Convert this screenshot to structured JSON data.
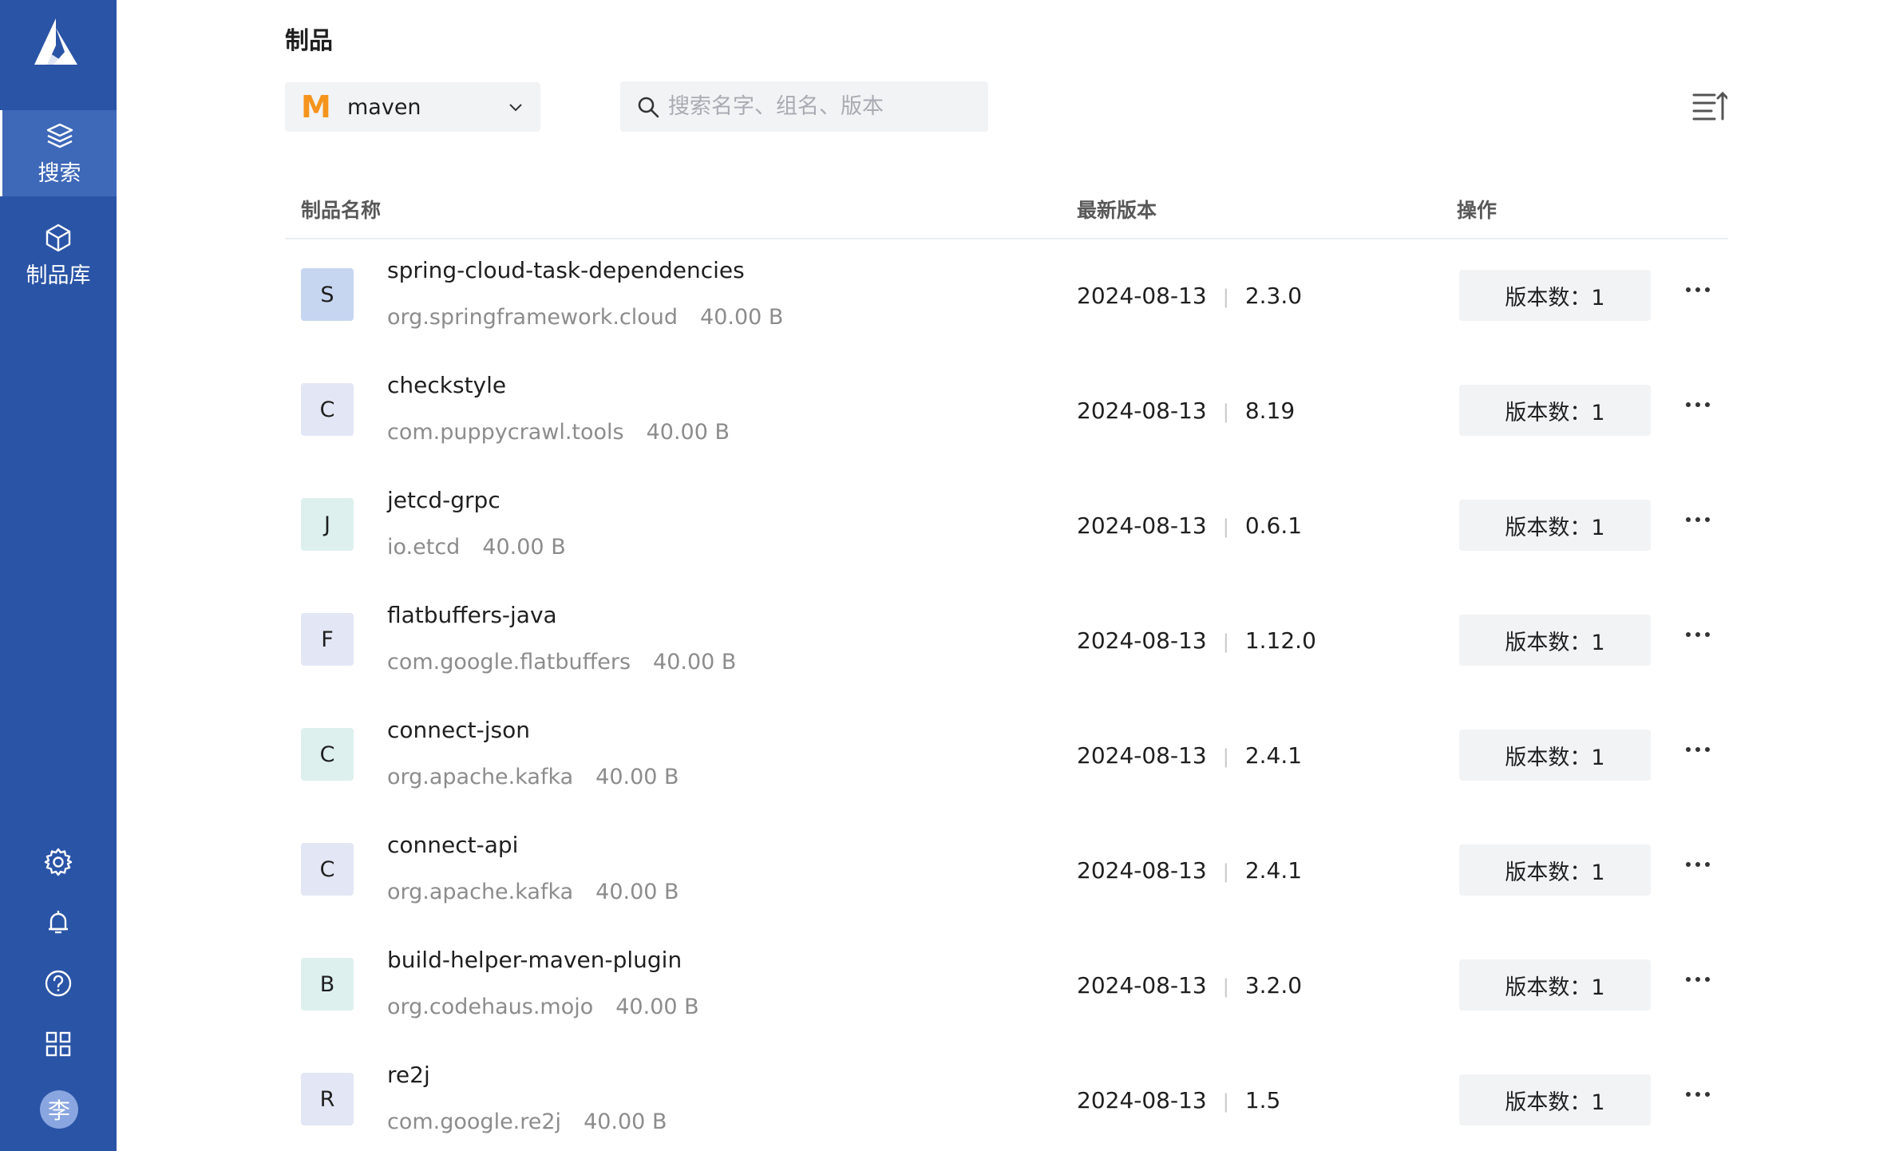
{
  "sidebar": {
    "nav": [
      {
        "label": "搜索",
        "icon": "layers-icon"
      },
      {
        "label": "制品库",
        "icon": "cube-icon"
      }
    ],
    "bottom_icons": [
      "gear-icon",
      "bell-icon",
      "help-icon",
      "apps-grid-icon"
    ],
    "avatar_text": "李",
    "colors": {
      "background": "#2a54a6",
      "active": "#3e68b8"
    }
  },
  "page": {
    "title": "制品",
    "repo_select": {
      "logo": "M",
      "value": "maven"
    },
    "search": {
      "placeholder": "搜索名字、组名、版本"
    }
  },
  "table": {
    "headers": {
      "name": "制品名称",
      "latest": "最新版本",
      "action": "操作"
    },
    "rows": [
      {
        "initial": "S",
        "badge_color": "#c6d6f1",
        "name": "spring-cloud-task-dependencies",
        "group": "org.springframework.cloud",
        "size": "40.00 B",
        "date": "2024-08-13",
        "version": "2.3.0",
        "versions_label": "版本数：1"
      },
      {
        "initial": "C",
        "badge_color": "#e3e6f4",
        "name": "checkstyle",
        "group": "com.puppycrawl.tools",
        "size": "40.00 B",
        "date": "2024-08-13",
        "version": "8.19",
        "versions_label": "版本数：1"
      },
      {
        "initial": "J",
        "badge_color": "#ddf0ee",
        "name": "jetcd-grpc",
        "group": "io.etcd",
        "size": "40.00 B",
        "date": "2024-08-13",
        "version": "0.6.1",
        "versions_label": "版本数：1"
      },
      {
        "initial": "F",
        "badge_color": "#e3e6f4",
        "name": "flatbuffers-java",
        "group": "com.google.flatbuffers",
        "size": "40.00 B",
        "date": "2024-08-13",
        "version": "1.12.0",
        "versions_label": "版本数：1"
      },
      {
        "initial": "C",
        "badge_color": "#ddf0ee",
        "name": "connect-json",
        "group": "org.apache.kafka",
        "size": "40.00 B",
        "date": "2024-08-13",
        "version": "2.4.1",
        "versions_label": "版本数：1"
      },
      {
        "initial": "C",
        "badge_color": "#e3e6f4",
        "name": "connect-api",
        "group": "org.apache.kafka",
        "size": "40.00 B",
        "date": "2024-08-13",
        "version": "2.4.1",
        "versions_label": "版本数：1"
      },
      {
        "initial": "B",
        "badge_color": "#ddf0ee",
        "name": "build-helper-maven-plugin",
        "group": "org.codehaus.mojo",
        "size": "40.00 B",
        "date": "2024-08-13",
        "version": "3.2.0",
        "versions_label": "版本数：1"
      },
      {
        "initial": "R",
        "badge_color": "#e3e6f4",
        "name": "re2j",
        "group": "com.google.re2j",
        "size": "40.00 B",
        "date": "2024-08-13",
        "version": "1.5",
        "versions_label": "版本数：1"
      }
    ],
    "more_icon": "more-horizontal-icon"
  }
}
